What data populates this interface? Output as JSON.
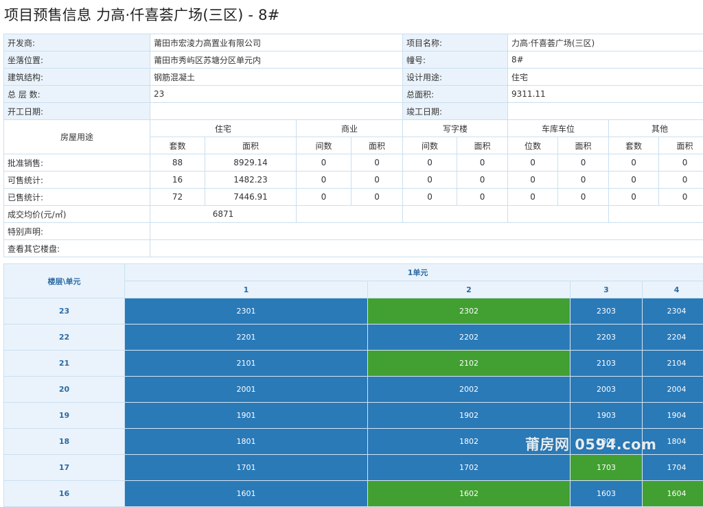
{
  "title": "项目预售信息 力高·仟喜荟广场(三区) - 8#",
  "info": {
    "developer_label": "开发商:",
    "developer": "莆田市宏淩力高置业有限公司",
    "project_label": "项目名称:",
    "project": "力高·仟喜荟广场(三区)",
    "location_label": "坐落位置:",
    "location": "莆田市秀屿区苏塘分区单元内",
    "building_label": "幢号:",
    "building": "8#",
    "structure_label": "建筑结构:",
    "structure": "钢筋混凝土",
    "usage_label": "设计用途:",
    "usage": "住宅",
    "floors_label": "总 层 数:",
    "floors": "23",
    "area_label": "总面积:",
    "area": "9311.11",
    "start_label": "开工日期:",
    "start": "",
    "finish_label": "竣工日期:",
    "finish": ""
  },
  "stats": {
    "purpose_label": "房屋用途",
    "groups": [
      "住宅",
      "商业",
      "写字楼",
      "车库车位",
      "其他"
    ],
    "subheaders": [
      "套数",
      "面积",
      "间数",
      "面积",
      "间数",
      "面积",
      "位数",
      "面积",
      "套数",
      "面积"
    ],
    "rows": [
      {
        "label": "批准销售:",
        "values": [
          "88",
          "8929.14",
          "0",
          "0",
          "0",
          "0",
          "0",
          "0",
          "0",
          "0"
        ]
      },
      {
        "label": "可售统计:",
        "values": [
          "16",
          "1482.23",
          "0",
          "0",
          "0",
          "0",
          "0",
          "0",
          "0",
          "0"
        ]
      },
      {
        "label": "已售统计:",
        "values": [
          "72",
          "7446.91",
          "0",
          "0",
          "0",
          "0",
          "0",
          "0",
          "0",
          "0"
        ]
      }
    ],
    "avg_price_label": "成交均价(元/㎡)",
    "avg_price": "6871",
    "special_label": "特别声明:",
    "other_label": "查看其它楼盘:"
  },
  "units": {
    "corner_label": "楼层\\单元",
    "group_label": "1单元",
    "columns": [
      "1",
      "2",
      "3",
      "4"
    ],
    "colors": {
      "available": "#2a7ab8",
      "sold": "#42a032"
    },
    "floors": [
      {
        "floor": "23",
        "units": [
          {
            "no": "2301",
            "status": "blue"
          },
          {
            "no": "2302",
            "status": "green"
          },
          {
            "no": "2303",
            "status": "blue"
          },
          {
            "no": "2304",
            "status": "blue"
          }
        ]
      },
      {
        "floor": "22",
        "units": [
          {
            "no": "2201",
            "status": "blue"
          },
          {
            "no": "2202",
            "status": "blue"
          },
          {
            "no": "2203",
            "status": "blue"
          },
          {
            "no": "2204",
            "status": "blue"
          }
        ]
      },
      {
        "floor": "21",
        "units": [
          {
            "no": "2101",
            "status": "blue"
          },
          {
            "no": "2102",
            "status": "green"
          },
          {
            "no": "2103",
            "status": "blue"
          },
          {
            "no": "2104",
            "status": "blue"
          }
        ]
      },
      {
        "floor": "20",
        "units": [
          {
            "no": "2001",
            "status": "blue"
          },
          {
            "no": "2002",
            "status": "blue"
          },
          {
            "no": "2003",
            "status": "blue"
          },
          {
            "no": "2004",
            "status": "blue"
          }
        ]
      },
      {
        "floor": "19",
        "units": [
          {
            "no": "1901",
            "status": "blue"
          },
          {
            "no": "1902",
            "status": "blue"
          },
          {
            "no": "1903",
            "status": "blue"
          },
          {
            "no": "1904",
            "status": "blue"
          }
        ]
      },
      {
        "floor": "18",
        "units": [
          {
            "no": "1801",
            "status": "blue"
          },
          {
            "no": "1802",
            "status": "blue"
          },
          {
            "no": "1803",
            "status": "blue"
          },
          {
            "no": "1804",
            "status": "blue"
          }
        ]
      },
      {
        "floor": "17",
        "units": [
          {
            "no": "1701",
            "status": "blue"
          },
          {
            "no": "1702",
            "status": "blue"
          },
          {
            "no": "1703",
            "status": "green"
          },
          {
            "no": "1704",
            "status": "blue"
          }
        ]
      },
      {
        "floor": "16",
        "units": [
          {
            "no": "1601",
            "status": "blue"
          },
          {
            "no": "1602",
            "status": "green"
          },
          {
            "no": "1603",
            "status": "blue"
          },
          {
            "no": "1604",
            "status": "green"
          }
        ]
      }
    ]
  },
  "watermark": "莆房网 0594.com"
}
